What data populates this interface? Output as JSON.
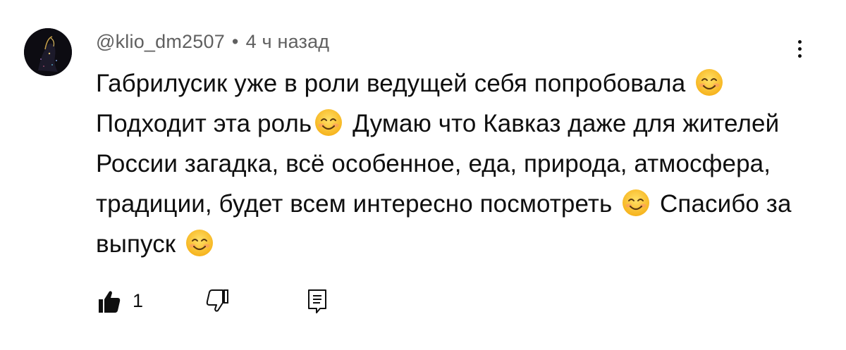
{
  "comment": {
    "username": "@klio_dm2507",
    "separator": "•",
    "time": "4 ч назад",
    "text_parts": [
      "Габрилусик уже в роли ведущей себя попробовала",
      "Подходит эта роль",
      "Думаю что Кавказ даже для жителей России загадка, всё особенное, еда, природа, атмосфера, традиции, будет всем интересно посмотреть",
      "Спасибо за выпуск"
    ],
    "emoji": "smiling-face-emoji"
  },
  "actions": {
    "like_count": "1",
    "like_icon": "thumbs-up-filled-icon",
    "dislike_icon": "thumbs-down-outline-icon",
    "reply_icon": "reply-comment-icon"
  },
  "menu_icon": "more-vertical-icon"
}
